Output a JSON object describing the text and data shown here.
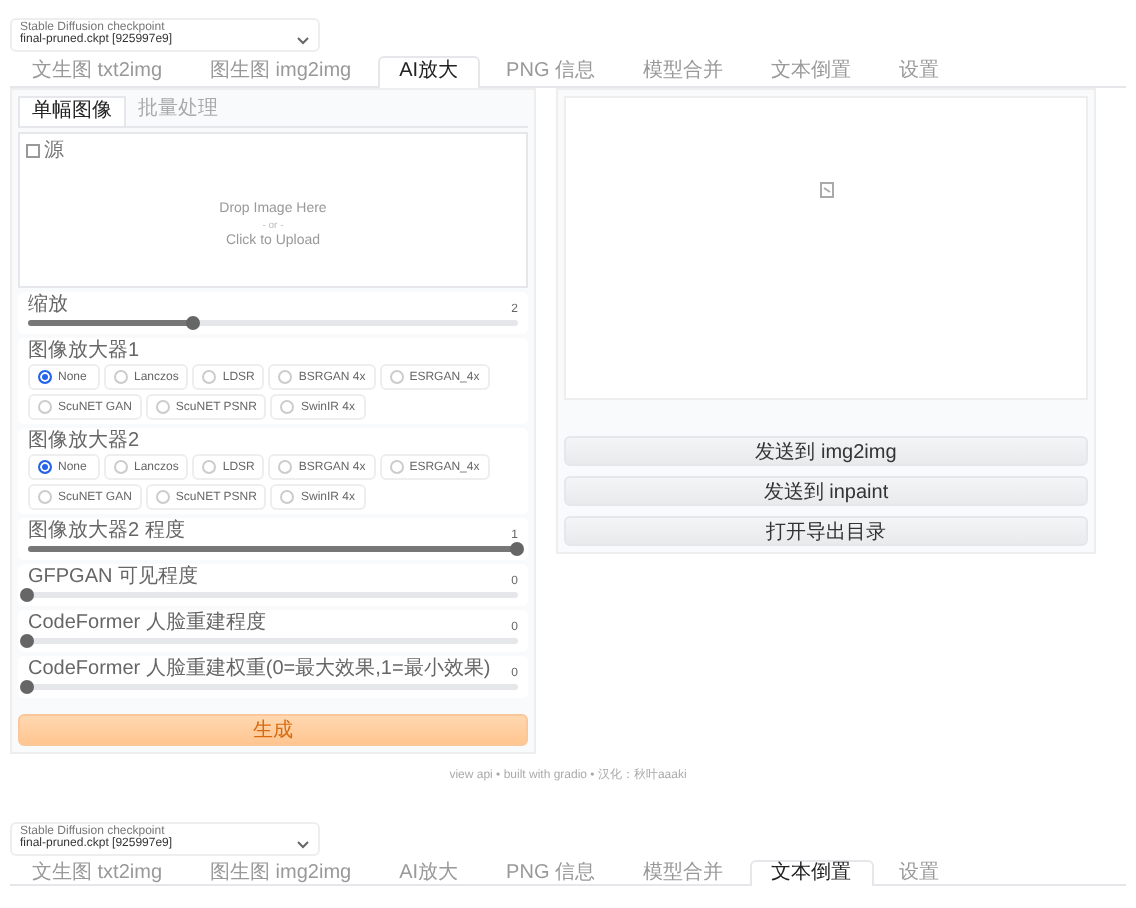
{
  "checkpoint": {
    "label": "Stable Diffusion checkpoint",
    "value": "final-pruned.ckpt [925997e9]"
  },
  "tabs": [
    {
      "label": "文生图 txt2img",
      "selected": false
    },
    {
      "label": "图生图 img2img",
      "selected": false
    },
    {
      "label": "AI放大",
      "selected": true
    },
    {
      "label": "PNG 信息",
      "selected": false
    },
    {
      "label": "模型合并",
      "selected": false
    },
    {
      "label": "文本倒置",
      "selected": false
    },
    {
      "label": "设置",
      "selected": false
    }
  ],
  "subtabs": [
    {
      "label": "单幅图像",
      "selected": true
    },
    {
      "label": "批量处理",
      "selected": false
    }
  ],
  "source": {
    "label": "源",
    "drop_text": "Drop Image Here",
    "or_text": "- or -",
    "upload_text": "Click to Upload"
  },
  "controls": [
    {
      "kind": "slider",
      "label": "缩放",
      "reading": "2",
      "level": 0.34
    },
    {
      "kind": "radio",
      "label": "图像放大器1",
      "options": [
        {
          "label": "None",
          "selected": true
        },
        {
          "label": "Lanczos",
          "selected": false
        },
        {
          "label": "LDSR",
          "selected": false
        },
        {
          "label": "BSRGAN 4x",
          "selected": false
        },
        {
          "label": "ESRGAN_4x",
          "selected": false
        },
        {
          "label": "ScuNET GAN",
          "selected": false
        },
        {
          "label": "ScuNET PSNR",
          "selected": false
        },
        {
          "label": "SwinIR 4x",
          "selected": false
        }
      ]
    },
    {
      "kind": "radio",
      "label": "图像放大器2",
      "options": [
        {
          "label": "None",
          "selected": true
        },
        {
          "label": "Lanczos",
          "selected": false
        },
        {
          "label": "LDSR",
          "selected": false
        },
        {
          "label": "BSRGAN 4x",
          "selected": false
        },
        {
          "label": "ESRGAN_4x",
          "selected": false
        },
        {
          "label": "ScuNET GAN",
          "selected": false
        },
        {
          "label": "ScuNET PSNR",
          "selected": false
        },
        {
          "label": "SwinIR 4x",
          "selected": false
        }
      ]
    },
    {
      "kind": "slider",
      "label": "图像放大器2 程度",
      "reading": "1",
      "level": 1
    },
    {
      "kind": "slider",
      "label": "GFPGAN 可见程度",
      "reading": "0",
      "level": 0
    },
    {
      "kind": "slider",
      "label": "CodeFormer 人脸重建程度",
      "reading": "0",
      "level": 0
    },
    {
      "kind": "slider",
      "label": "CodeFormer 人脸重建权重(0=最大效果,1=最小效果)",
      "reading": "0",
      "level": 0
    }
  ],
  "generate_button": "生成",
  "output_buttons": [
    "发送到 img2img",
    "发送到 inpaint",
    "打开导出目录"
  ],
  "footer": "view api • built with gradio • 汉化：秋叶aaaki",
  "second_copy": {
    "checkpoint": {
      "label": "Stable Diffusion checkpoint",
      "value": "final-pruned.ckpt [925997e9]"
    },
    "tabs": [
      {
        "label": "文生图 txt2img",
        "selected": false
      },
      {
        "label": "图生图 img2img",
        "selected": false
      },
      {
        "label": "AI放大",
        "selected": false
      },
      {
        "label": "PNG 信息",
        "selected": false
      },
      {
        "label": "模型合并",
        "selected": false
      },
      {
        "label": "文本倒置",
        "selected": true
      },
      {
        "label": "设置",
        "selected": false
      }
    ]
  }
}
